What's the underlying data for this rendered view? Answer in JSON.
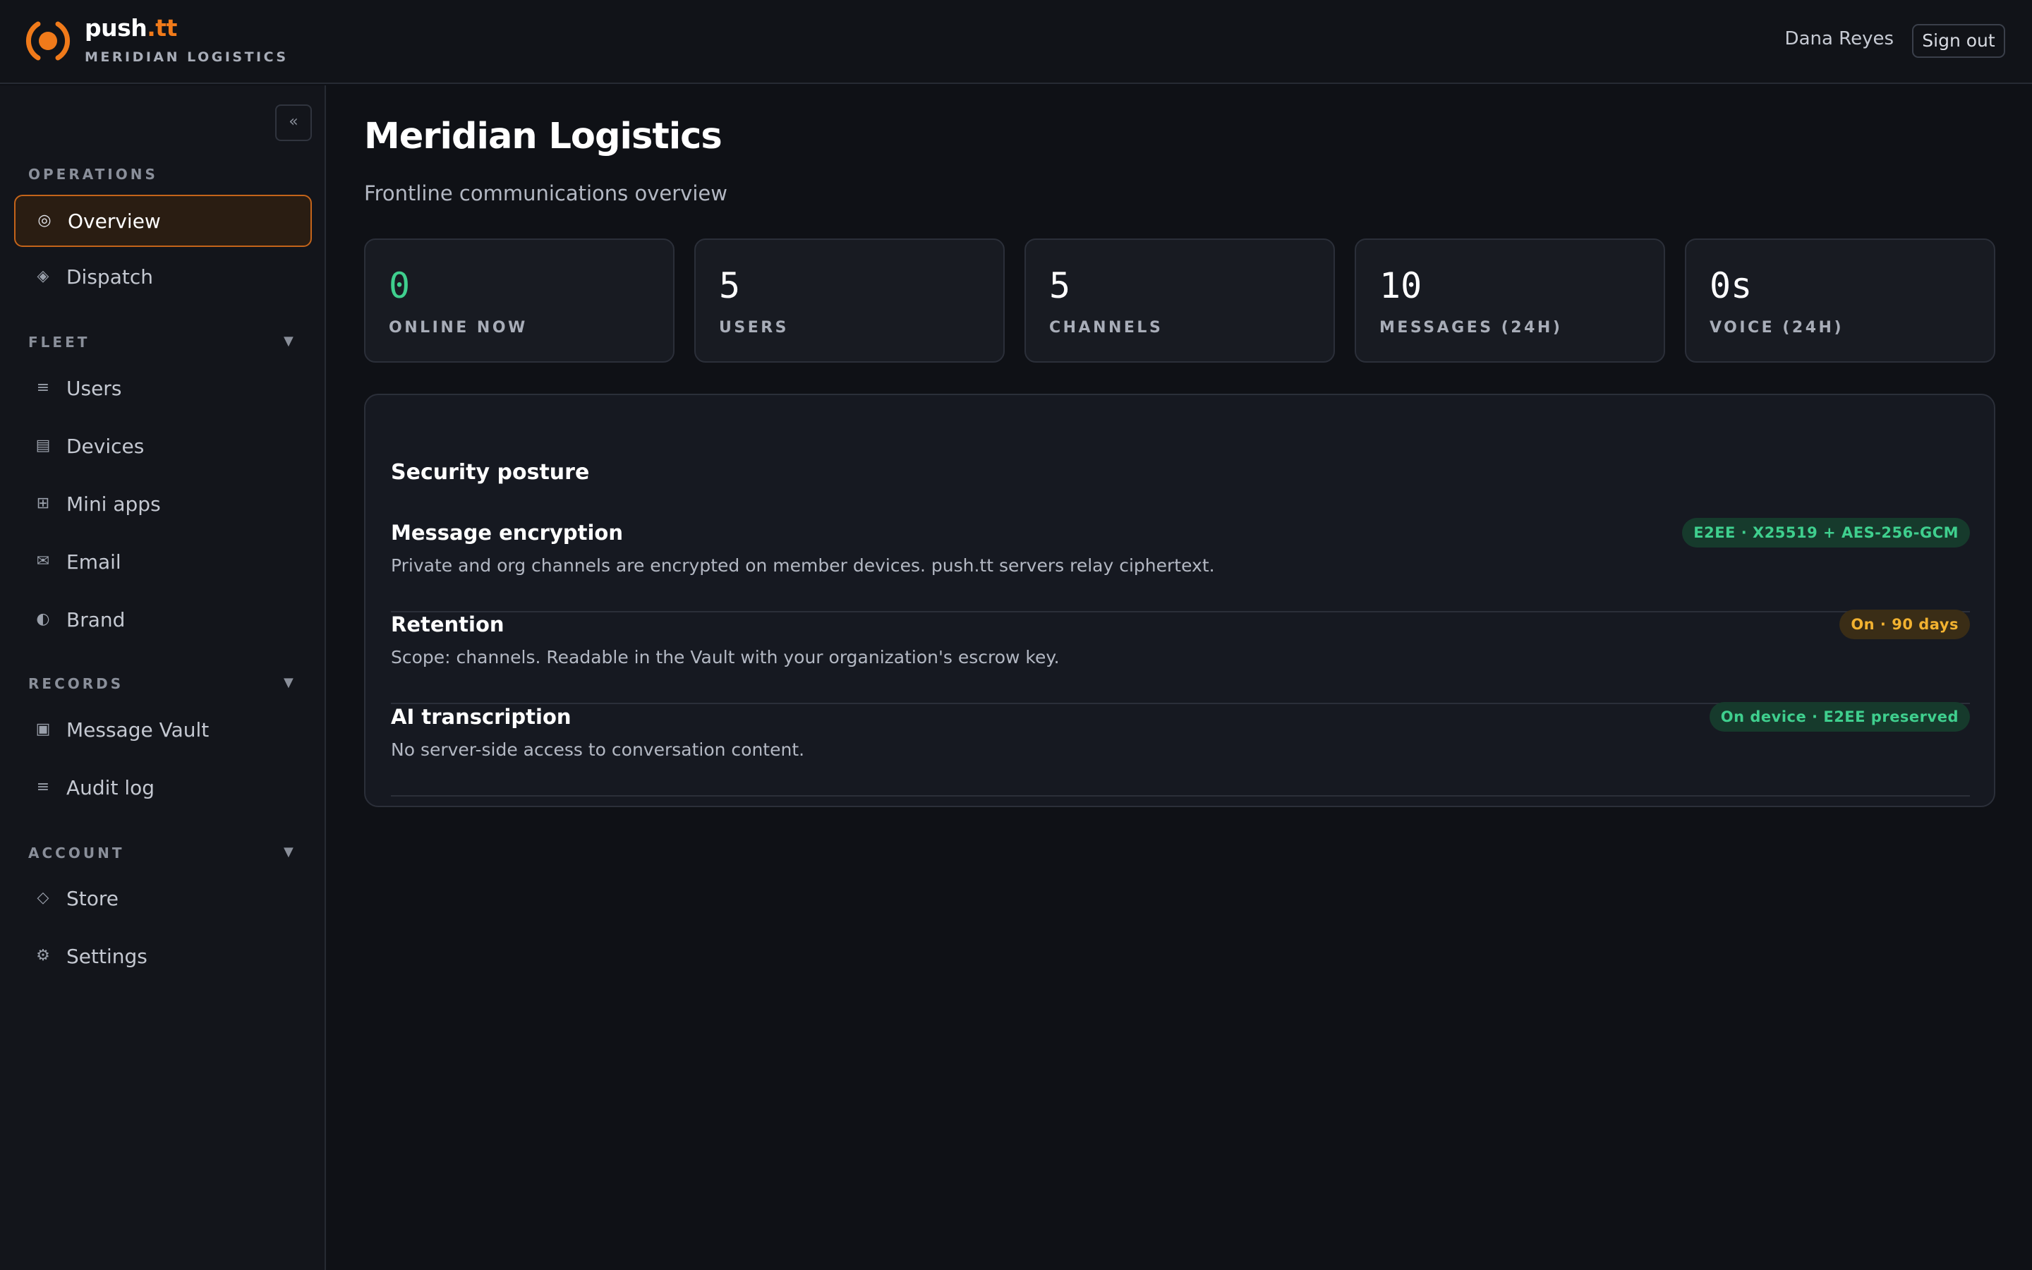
{
  "header": {
    "brand_name": "push",
    "brand_tld": ".tt",
    "org_name": "MERIDIAN LOGISTICS",
    "user_name": "Dana Reyes",
    "signout_label": "Sign out"
  },
  "sidebar": {
    "collapse_glyph": "«",
    "sections": {
      "operations": {
        "label": "OPERATIONS"
      },
      "fleet": {
        "label": "FLEET",
        "caret": "▼"
      },
      "records": {
        "label": "RECORDS",
        "caret": "▼"
      },
      "account": {
        "label": "ACCOUNT",
        "caret": "▼"
      }
    },
    "items": {
      "overview": {
        "label": "Overview",
        "icon": "target-icon",
        "glyph": "◎",
        "active": true
      },
      "dispatch": {
        "label": "Dispatch",
        "icon": "diamond-icon",
        "glyph": "◈"
      },
      "users": {
        "label": "Users",
        "icon": "list-icon",
        "glyph": "≡"
      },
      "devices": {
        "label": "Devices",
        "icon": "device-icon",
        "glyph": "▤"
      },
      "mini_apps": {
        "label": "Mini apps",
        "icon": "grid-icon",
        "glyph": "⊞"
      },
      "email": {
        "label": "Email",
        "icon": "envelope-icon",
        "glyph": "✉"
      },
      "brand": {
        "label": "Brand",
        "icon": "contrast-icon",
        "glyph": "◐"
      },
      "message_vault": {
        "label": "Message Vault",
        "icon": "vault-icon",
        "glyph": "▣"
      },
      "audit_log": {
        "label": "Audit log",
        "icon": "list-icon",
        "glyph": "≡"
      },
      "store": {
        "label": "Store",
        "icon": "diamond-outline-icon",
        "glyph": "◇"
      },
      "settings": {
        "label": "Settings",
        "icon": "gear-icon",
        "glyph": "⚙"
      }
    }
  },
  "main": {
    "title": "Meridian Logistics",
    "subtitle": "Frontline communications overview",
    "stats": [
      {
        "value": "0",
        "label": "ONLINE NOW",
        "color": "#3fcf8e"
      },
      {
        "value": "5",
        "label": "USERS"
      },
      {
        "value": "5",
        "label": "CHANNELS"
      },
      {
        "value": "10",
        "label": "MESSAGES (24H)"
      },
      {
        "value": "0s",
        "label": "VOICE (24H)"
      }
    ],
    "security": {
      "title": "Security posture",
      "rows": [
        {
          "name": "Message encryption",
          "desc": "Private and org channels are encrypted on member devices. push.tt servers relay ciphertext.",
          "badge": "E2EE · X25519 + AES-256-GCM",
          "badge_color": "#3fcf8e"
        },
        {
          "name": "Retention",
          "desc": "Scope: channels. Readable in the Vault with your organization's escrow key.",
          "badge": "On · 90 days",
          "badge_color": "#f2b230"
        },
        {
          "name": "AI transcription",
          "desc": "No server-side access to conversation content.",
          "badge": "On device · E2EE preserved",
          "badge_color": "#3fcf8e"
        }
      ]
    }
  },
  "colors": {
    "accent": "#f07a1a",
    "background": "#0f1116",
    "success": "#3fcf8e",
    "warning": "#f2b230"
  }
}
